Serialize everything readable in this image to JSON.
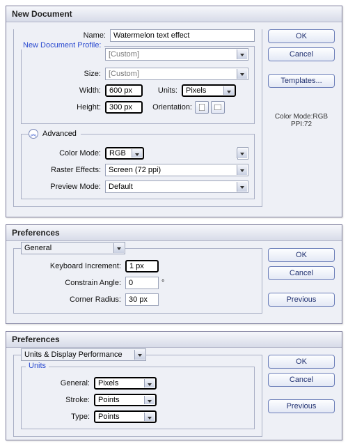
{
  "newDoc": {
    "title": "New Document",
    "labels": {
      "name": "Name:",
      "profile": "New Document Profile:",
      "size": "Size:",
      "width": "Width:",
      "height": "Height:",
      "units": "Units:",
      "orientation": "Orientation:",
      "advanced": "Advanced",
      "colorMode": "Color Mode:",
      "rasterEffects": "Raster Effects:",
      "previewMode": "Preview Mode:"
    },
    "values": {
      "name": "Watermelon text effect",
      "profile": "[Custom]",
      "size": "[Custom]",
      "width": "600 px",
      "height": "300 px",
      "units": "Pixels",
      "colorMode": "RGB",
      "rasterEffects": "Screen (72 ppi)",
      "previewMode": "Default"
    },
    "buttons": {
      "ok": "OK",
      "cancel": "Cancel",
      "templates": "Templates..."
    },
    "info1": "Color Mode:RGB",
    "info2": "PPI:72"
  },
  "prefs1": {
    "title": "Preferences",
    "section": "General",
    "labels": {
      "keyboard": "Keyboard Increment:",
      "constrain": "Constrain Angle:",
      "corner": "Corner Radius:"
    },
    "values": {
      "keyboard": "1 px",
      "constrain": "0",
      "corner": "30 px"
    },
    "buttons": {
      "ok": "OK",
      "cancel": "Cancel",
      "previous": "Previous"
    }
  },
  "prefs2": {
    "title": "Preferences",
    "section": "Units & Display Performance",
    "unitsGroup": "Units",
    "labels": {
      "general": "General:",
      "stroke": "Stroke:",
      "type": "Type:"
    },
    "values": {
      "general": "Pixels",
      "stroke": "Points",
      "type": "Points"
    },
    "buttons": {
      "ok": "OK",
      "cancel": "Cancel",
      "previous": "Previous"
    }
  }
}
